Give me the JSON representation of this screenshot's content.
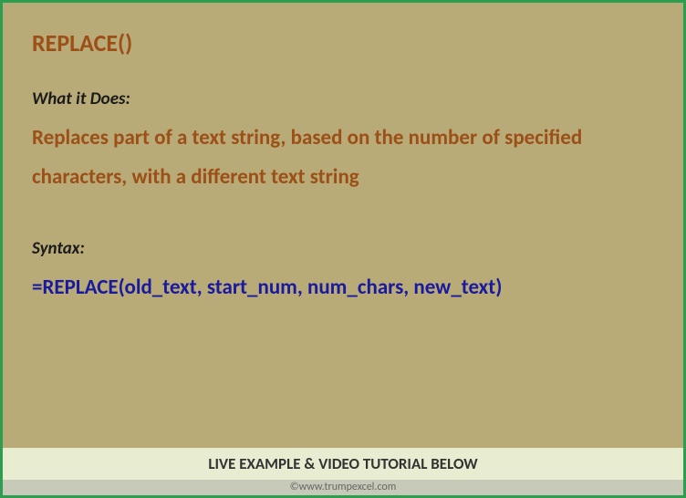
{
  "title": "REPLACE()",
  "sections": {
    "what_label": "What it Does:",
    "what_description": "Replaces part of a text string, based on the number of specified characters, with a different text string",
    "syntax_label": "Syntax:",
    "syntax_text": "=REPLACE(old_text, start_num, num_chars, new_text)"
  },
  "footer": {
    "cta": "LIVE EXAMPLE & VIDEO TUTORIAL BELOW",
    "copyright": "©www.trumpexcel.com"
  }
}
